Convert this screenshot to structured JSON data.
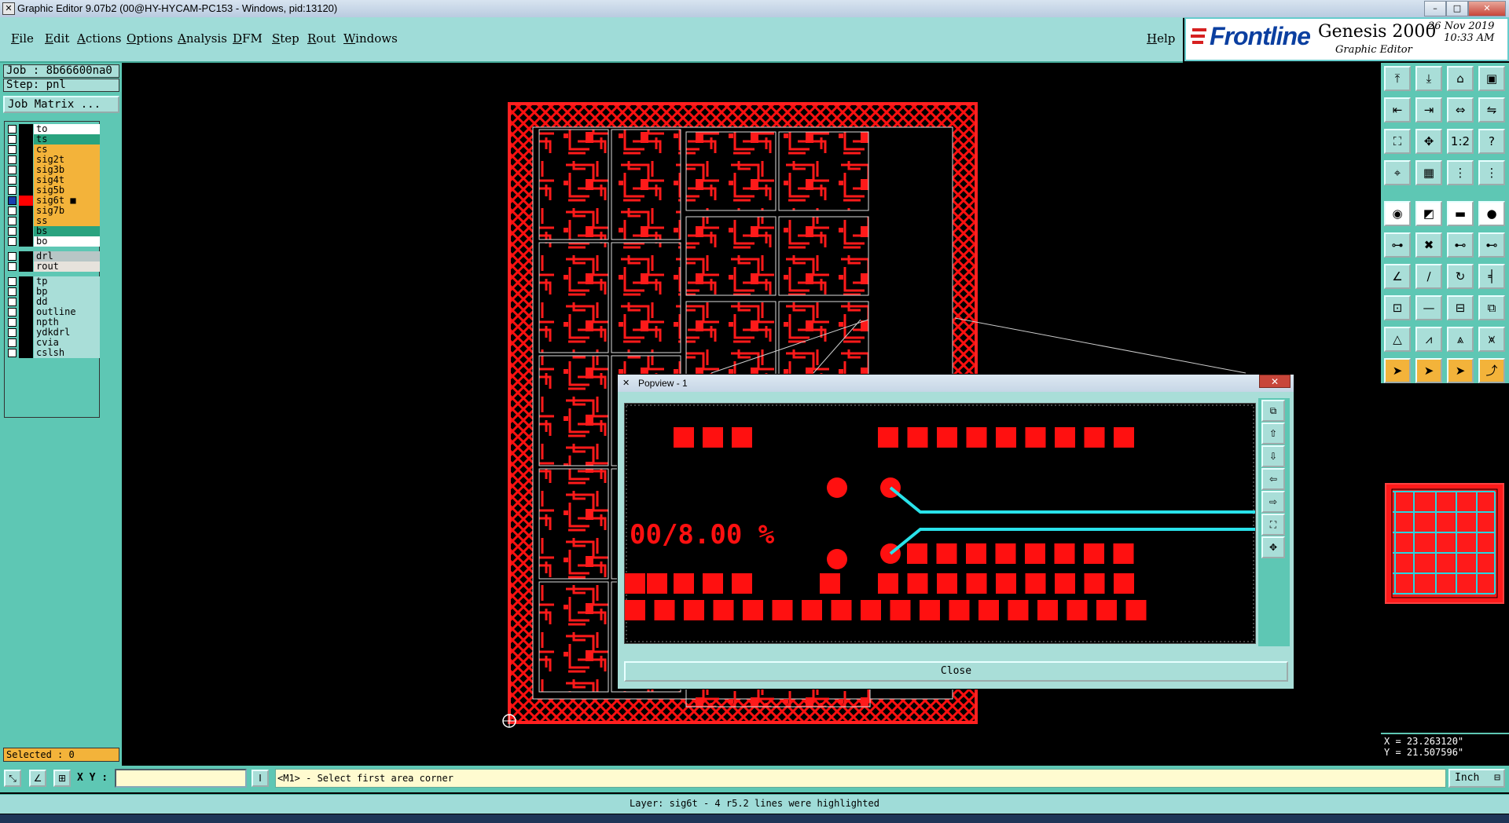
{
  "window": {
    "title": "Graphic Editor 9.07b2 (00@HY-HYCAM-PC153 - Windows, pid:13120)",
    "min_label": "–",
    "max_label": "□",
    "close_label": "✕"
  },
  "menu": {
    "items": [
      "File",
      "Edit",
      "Actions",
      "Options",
      "Analysis",
      "DFM",
      "Step",
      "Rout",
      "Windows"
    ],
    "help": "Help"
  },
  "brand": {
    "logo_text": "Frontline",
    "product": "Genesis 2000",
    "subtitle": "Graphic Editor",
    "date": "26 Nov 2019",
    "time": "10:33 AM",
    "accent_color": "#0b3fa0"
  },
  "job": {
    "job_line": "Job : 8b66600na0",
    "step_line": "Step: pnl",
    "matrix_button": "Job Matrix ..."
  },
  "layers": [
    {
      "name": "to",
      "color": "#ffffff",
      "checked": false
    },
    {
      "name": "ts",
      "color": "#2aa37f",
      "checked": false
    },
    {
      "name": "cs",
      "color": "#f3b33a",
      "checked": false
    },
    {
      "name": "sig2t",
      "color": "#f3b33a",
      "checked": false
    },
    {
      "name": "sig3b",
      "color": "#f3b33a",
      "checked": false
    },
    {
      "name": "sig4t",
      "color": "#f3b33a",
      "checked": false
    },
    {
      "name": "sig5b",
      "color": "#f3b33a",
      "checked": false
    },
    {
      "name": "sig6t",
      "color": "#f3b33a",
      "checked": true,
      "swatch": "#ff0000",
      "mark": "■"
    },
    {
      "name": "sig7b",
      "color": "#f3b33a",
      "checked": false
    },
    {
      "name": "ss",
      "color": "#f3b33a",
      "checked": false
    },
    {
      "name": "bs",
      "color": "#2aa37f",
      "checked": false
    },
    {
      "name": "bo",
      "color": "#ffffff",
      "checked": false
    },
    {
      "name": "drl",
      "color": "#b8c6c6",
      "checked": false
    },
    {
      "name": "rout",
      "color": "#e6e2dc",
      "checked": false
    },
    {
      "name": "tp",
      "color": "#a9ded8",
      "checked": false
    },
    {
      "name": "bp",
      "color": "#a9ded8",
      "checked": false
    },
    {
      "name": "dd",
      "color": "#a9ded8",
      "checked": false
    },
    {
      "name": "outline",
      "color": "#a9ded8",
      "checked": false
    },
    {
      "name": "npth",
      "color": "#a9ded8",
      "checked": false
    },
    {
      "name": "ydkdrl",
      "color": "#a9ded8",
      "checked": false
    },
    {
      "name": "cvia",
      "color": "#a9ded8",
      "checked": false
    },
    {
      "name": "cslsh",
      "color": "#a9ded8",
      "checked": false
    }
  ],
  "selected": "Selected : 0",
  "toolbar_icons": [
    "open-icon",
    "save-icon",
    "home-icon",
    "window-icon",
    "zoom-prev-icon",
    "zoom-next-icon",
    "fit-icon",
    "snap-icon",
    "zoom-extents-icon",
    "pan-icon",
    "scale-icon",
    "help-icon",
    "measure-icon",
    "grid-icon",
    "layers-icon",
    "display-icon",
    "pad-icon",
    "corner-icon",
    "ruler-icon",
    "dot-icon",
    "connect-icon",
    "cross-icon",
    "node-icon",
    "node2-icon",
    "line-icon",
    "line2-icon",
    "arc-icon",
    "split-icon",
    "move-icon",
    "delete-icon",
    "resize-icon",
    "shape-icon",
    "poly-icon",
    "poly2-icon",
    "poly3-icon",
    "poly4-icon",
    "pointer-icon",
    "pointer2-icon",
    "pointer3-icon",
    "pointer4-icon"
  ],
  "coords": {
    "x": "X = 23.263120\"",
    "y": "Y = 21.507596\""
  },
  "cmd": {
    "xy_label": "X Y :",
    "xy_value": "",
    "prompt": "<M1> - Select first area corner",
    "unit": "Inch"
  },
  "status": "Layer: sig6t - 4 r5.2 lines were highlighted",
  "popview": {
    "title": "Popview - 1",
    "close_button": "Close",
    "canvas_text": "00/8.00 %"
  }
}
